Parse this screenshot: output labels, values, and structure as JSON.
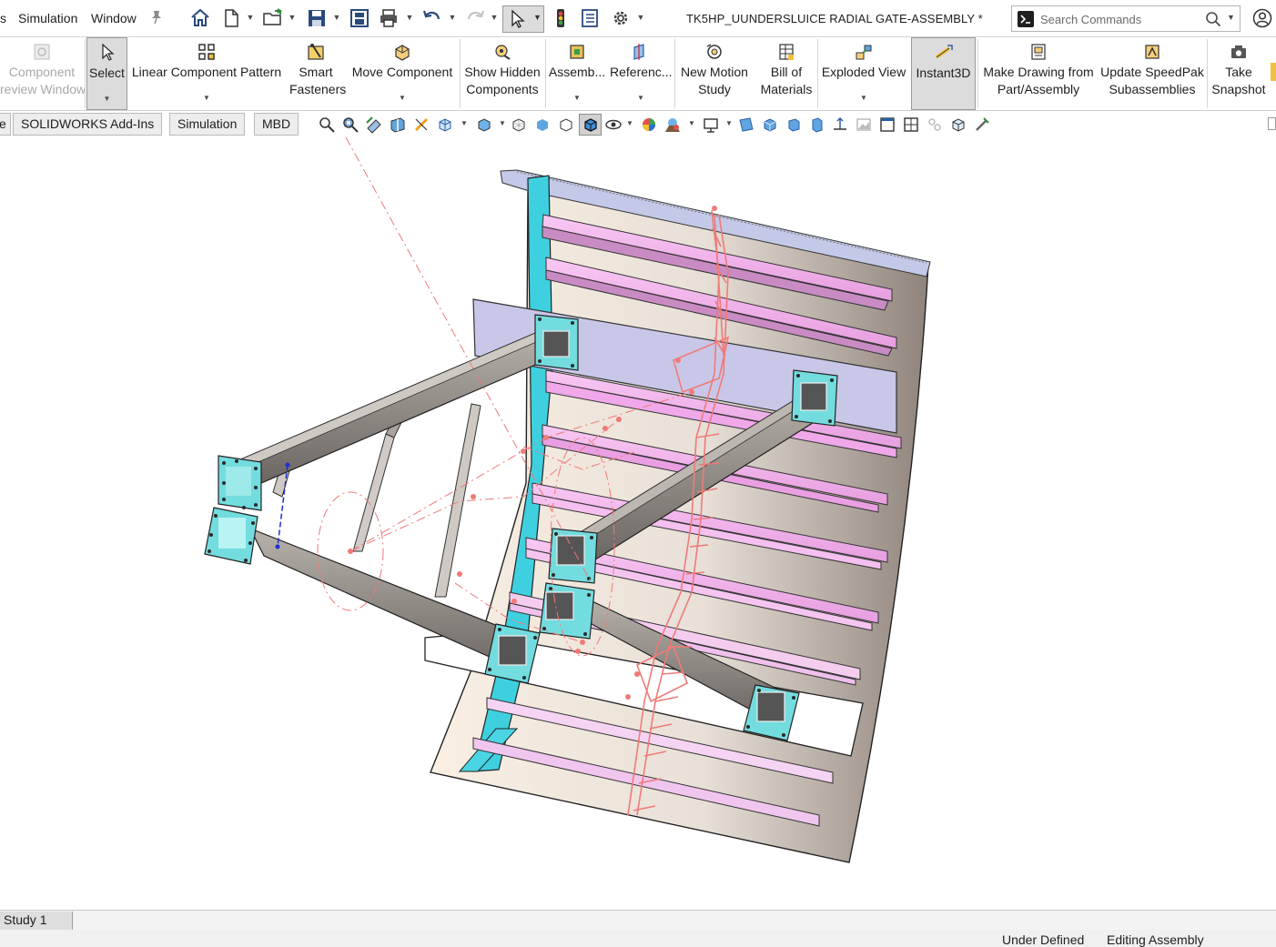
{
  "window": {
    "document_title": "TK5HP_UUNDERSLUICE RADIAL GATE-ASSEMBLY *"
  },
  "menu": {
    "items": [
      "s",
      "Simulation",
      "Window"
    ]
  },
  "search": {
    "placeholder": "Search Commands"
  },
  "ribbon": {
    "buttons": [
      {
        "label1": "Component",
        "label2": "review Window"
      },
      {
        "label1": "Select"
      },
      {
        "label1": "Linear Component Pattern"
      },
      {
        "label1": "Smart",
        "label2": "Fasteners"
      },
      {
        "label1": "Move Component"
      },
      {
        "label1": "Show Hidden",
        "label2": "Components"
      },
      {
        "label1": "Assemb..."
      },
      {
        "label1": "Referenc..."
      },
      {
        "label1": "New Motion",
        "label2": "Study"
      },
      {
        "label1": "Bill of",
        "label2": "Materials"
      },
      {
        "label1": "Exploded View"
      },
      {
        "label1": "Instant3D"
      },
      {
        "label1": "Make Drawing from",
        "label2": "Part/Assembly"
      },
      {
        "label1": "Update SpeedPak",
        "label2": "Subassemblies"
      },
      {
        "label1": "Take",
        "label2": "Snapshot"
      }
    ]
  },
  "tabs": [
    "e",
    "SOLIDWORKS Add-Ins",
    "Simulation",
    "MBD"
  ],
  "study": {
    "tab_label": "Study 1"
  },
  "status": {
    "definition": "Under Defined",
    "mode": "Editing Assembly"
  },
  "colors": {
    "gate_skin": "#e9e2dc",
    "horizontal_girders": "#f3b6f0",
    "arms": "#6d6a66",
    "plates": "#73dcdf",
    "sketch": "#f07a78",
    "bracing": "#d0cbc6"
  }
}
